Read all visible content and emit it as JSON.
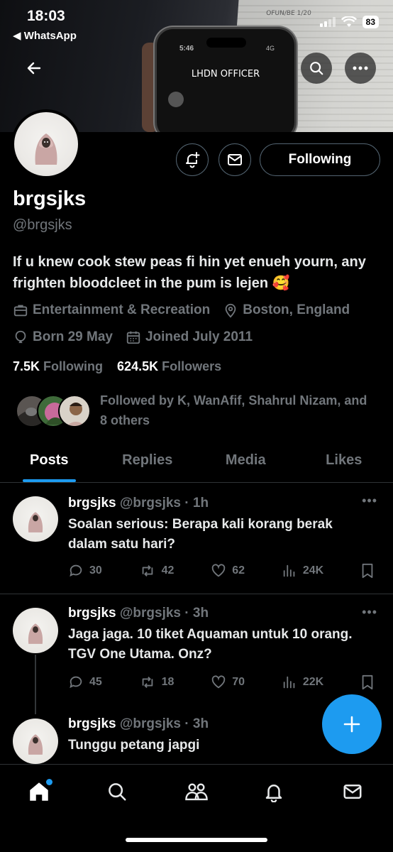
{
  "status_bar": {
    "time": "18:03",
    "back_app": "◀ WhatsApp",
    "battery": "83"
  },
  "banner": {
    "phone_time": "5:46",
    "phone_status": "4G",
    "caller_text": "LHDN OFFICER",
    "paper_mark": "OFUN/BE 1/20"
  },
  "profile": {
    "name": "brgsjks",
    "handle": "@brgsjks",
    "bio": "If u knew cook stew peas fi hin yet enueh yourn, any frighten bloodcleet in the pum is lejen 🥰",
    "category": "Entertainment & Recreation",
    "location": "Boston, England",
    "born": "Born 29 May",
    "joined": "Joined July 2011",
    "following_count": "7.5K",
    "following_label": "Following",
    "followers_count": "624.5K",
    "followers_label": "Followers",
    "followed_by": "Followed by K, WanAfif, Shahrul Nizam, and 8 others",
    "follow_button": "Following"
  },
  "tabs": [
    {
      "label": "Posts",
      "active": true
    },
    {
      "label": "Replies",
      "active": false
    },
    {
      "label": "Media",
      "active": false
    },
    {
      "label": "Likes",
      "active": false
    }
  ],
  "posts": [
    {
      "name": "brgsjks",
      "meta": "@brgsjks · 1h",
      "text": "Soalan serious: Berapa kali korang berak dalam satu hari?",
      "replies": "30",
      "reposts": "42",
      "likes": "62",
      "views": "24K"
    },
    {
      "name": "brgsjks",
      "meta": "@brgsjks · 3h",
      "text": "Jaga jaga. 10 tiket Aquaman untuk 10 orang. TGV One Utama. Onz?",
      "replies": "45",
      "reposts": "18",
      "likes": "70",
      "views": "22K"
    },
    {
      "name": "brgsjks",
      "meta": "@brgsjks · 3h",
      "text": "Tunggu petang japgi"
    }
  ],
  "colors": {
    "accent": "#1d9bf0",
    "muted": "#71767b",
    "border": "#2f3336"
  },
  "icons": {
    "back": "arrow-left-icon",
    "search": "search-icon",
    "more": "more-icon",
    "notify": "bell-plus-icon",
    "message": "envelope-icon",
    "category": "briefcase-icon",
    "location": "location-pin-icon",
    "born": "balloon-icon",
    "joined": "calendar-icon",
    "compose": "plus-icon"
  }
}
